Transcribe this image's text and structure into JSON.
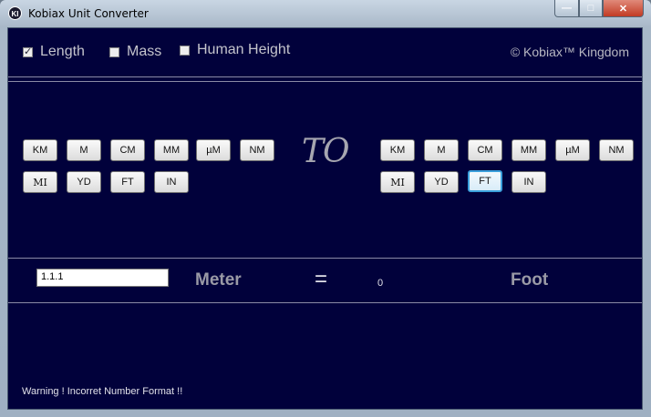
{
  "window": {
    "title": "Kobiax Unit Converter",
    "icon_text": "KI"
  },
  "window_controls": {
    "minimize": "—",
    "maximize": "□",
    "close": "✕"
  },
  "categories": [
    {
      "label": "Length",
      "checked": true
    },
    {
      "label": "Mass",
      "checked": false
    },
    {
      "label": "Human Height",
      "checked": false
    }
  ],
  "copyright": "© Kobiax™ Kingdom",
  "from_units": [
    "KM",
    "M",
    "CM",
    "MM",
    "µM",
    "NM",
    "MI",
    "YD",
    "FT",
    "IN"
  ],
  "to_label": "TO",
  "to_units": [
    "KM",
    "M",
    "CM",
    "MM",
    "µM",
    "NM",
    "MI",
    "YD",
    "FT",
    "IN"
  ],
  "selected_to_unit": "FT",
  "conversion": {
    "input_value": "1.1.1",
    "from_unit_name": "Meter",
    "equals": "=",
    "result": "0",
    "to_unit_name": "Foot"
  },
  "status": {
    "warning": "Warning ! Incorret Number Format !!"
  }
}
